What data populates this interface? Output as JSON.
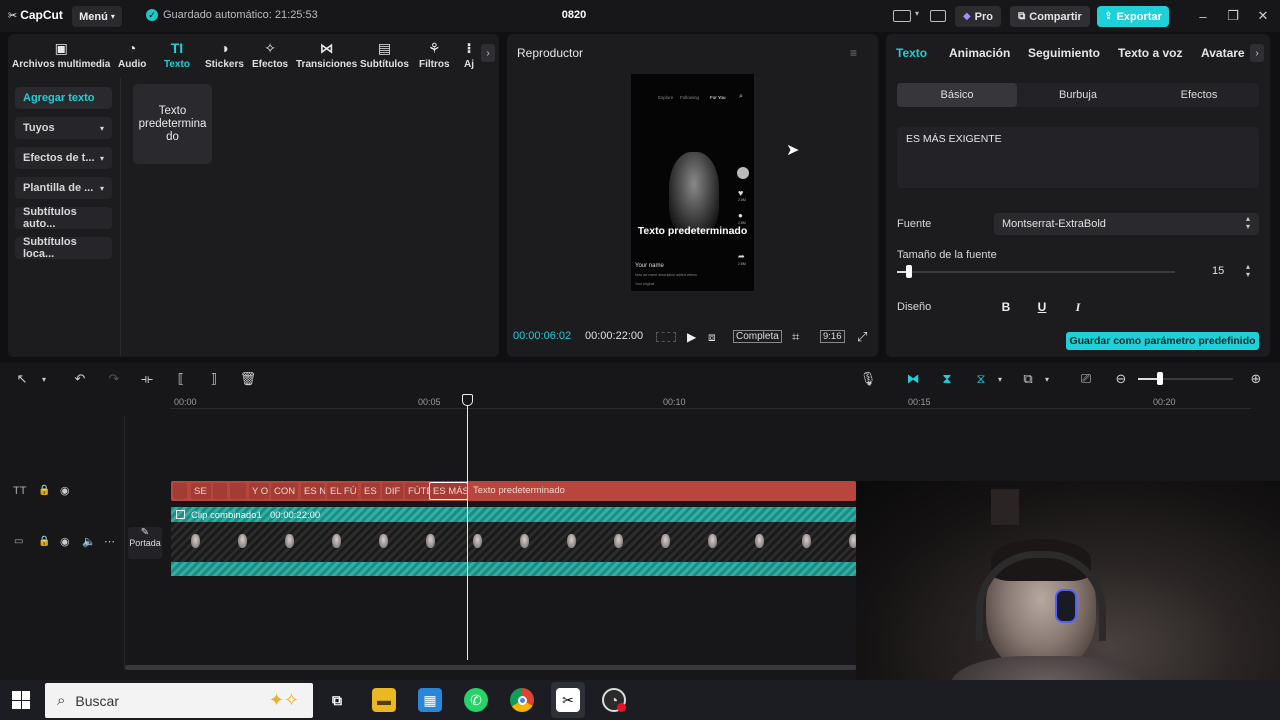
{
  "app": {
    "name": "CapCut",
    "menu_label": "Menú",
    "autosave": "Guardado automático: 21:25:53",
    "project_title": "0820"
  },
  "header": {
    "pro_label": "Pro",
    "share_label": "Compartir",
    "export_label": "Exportar"
  },
  "toolbar": {
    "items": [
      {
        "label": "Archivos multimedia",
        "icon": "media-icon"
      },
      {
        "label": "Audio",
        "icon": "audio-icon"
      },
      {
        "label": "Texto",
        "icon": "text-icon"
      },
      {
        "label": "Stickers",
        "icon": "sticker-icon"
      },
      {
        "label": "Efectos",
        "icon": "effects-icon"
      },
      {
        "label": "Transiciones",
        "icon": "transition-icon"
      },
      {
        "label": "Subtítulos",
        "icon": "subtitles-icon"
      },
      {
        "label": "Filtros",
        "icon": "filters-icon"
      },
      {
        "label": "Aj",
        "icon": "adjust-icon"
      }
    ]
  },
  "sidebar": {
    "items": [
      {
        "label": "Agregar texto"
      },
      {
        "label": "Tuyos"
      },
      {
        "label": "Efectos de t..."
      },
      {
        "label": "Plantilla de ..."
      },
      {
        "label": "Subtítulos auto..."
      },
      {
        "label": "Subtítulos loca..."
      }
    ]
  },
  "text_card": {
    "label": "Texto predetermina do"
  },
  "player": {
    "title": "Reproductor",
    "current_time": "00:00:06:02",
    "total_time": "00:00:22:00",
    "quality_label": "Completa",
    "ratio_label": "9:16",
    "phone": {
      "tabs": [
        "Explore",
        "Following",
        "For You"
      ],
      "caption": "Texto predeterminado",
      "username": "Your name",
      "desc1": "Now we name description added videos",
      "desc2": "Your original",
      "counts": [
        "2.8M",
        "2.8M",
        "2.8M"
      ]
    }
  },
  "inspector": {
    "tabs": [
      "Texto",
      "Animación",
      "Seguimiento",
      "Texto a voz",
      "Avatare"
    ],
    "sub_tabs": [
      "Básico",
      "Burbuja",
      "Efectos"
    ],
    "text_value": "ES MÁS EXIGENTE",
    "font_label": "Fuente",
    "font_value": "Montserrat-ExtraBold",
    "size_label": "Tamaño de la fuente",
    "size_value": "15",
    "size_fraction": 0.04,
    "design_label": "Diseño",
    "bold": "B",
    "underline": "U",
    "italic": "I",
    "save_preset_label": "Guardar como parámetro predefinido"
  },
  "timeline": {
    "ruler": [
      "00:00",
      "00:05",
      "00:10",
      "00:15",
      "00:20"
    ],
    "text_segments": [
      "SE",
      "Y O",
      "CON",
      "ES N",
      "EL FÚ",
      "ES I",
      "DIF",
      "FÚTE",
      "ES MÁS",
      "Texto predeterminado"
    ],
    "video_clip": {
      "name": "Clip combinado1",
      "duration": "00:00:22:00"
    },
    "cover_label": "Portada"
  },
  "taskbar": {
    "search_placeholder": "Buscar"
  },
  "colors": {
    "accent": "#1fd0d8",
    "text_track": "#b8463d",
    "video_track": "#2fb0a6"
  }
}
